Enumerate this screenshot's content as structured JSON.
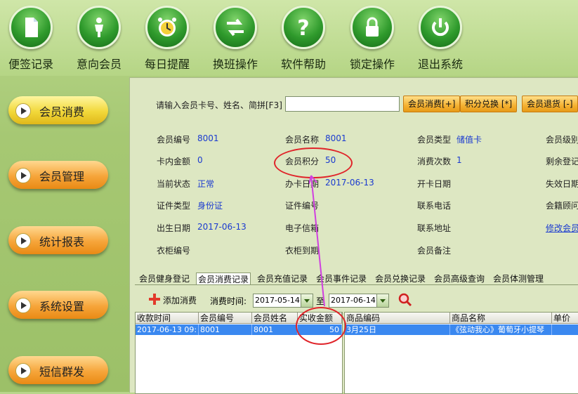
{
  "toolbar": [
    {
      "label": "便签记录",
      "icon": "document-icon"
    },
    {
      "label": "意向会员",
      "icon": "person-icon"
    },
    {
      "label": "每日提醒",
      "icon": "alarm-clock-icon"
    },
    {
      "label": "换班操作",
      "icon": "swap-arrows-icon"
    },
    {
      "label": "软件帮助",
      "icon": "question-icon"
    },
    {
      "label": "锁定操作",
      "icon": "lock-icon"
    },
    {
      "label": "退出系统",
      "icon": "power-icon"
    }
  ],
  "nav": [
    {
      "label": "会员消费",
      "style": "yellow"
    },
    {
      "label": "会员管理",
      "style": "orange"
    },
    {
      "label": "统计报表",
      "style": "orange"
    },
    {
      "label": "系统设置",
      "style": "orange"
    },
    {
      "label": "短信群发",
      "style": "orange"
    }
  ],
  "search": {
    "label": "请输入会员卡号、姓名、简拼[F3]",
    "value": "",
    "buttons": [
      "会员消费[+]",
      "积分兑换 [*]",
      "会员退货 [-]"
    ]
  },
  "member": {
    "r1": {
      "f1": "会员编号",
      "v1": "8001",
      "f2": "会员名称",
      "v2": "8001",
      "f3": "会员类型",
      "v3": "储值卡",
      "f4": "会员级别"
    },
    "r2": {
      "f1": "卡内金额",
      "v1": "0",
      "f2": "会员积分",
      "v2": "50",
      "f3": "消费次数",
      "v3": "1",
      "f4": "剩余登记"
    },
    "r3": {
      "f1": "当前状态",
      "v1": "正常",
      "f2": "办卡日期",
      "v2": "2017-06-13",
      "f3": "开卡日期",
      "f4": "失效日期"
    },
    "r4": {
      "f1": "证件类型",
      "v1": "身份证",
      "f2": "证件编号",
      "f3": "联系电话",
      "f4": "会籍顾问"
    },
    "r5": {
      "f1": "出生日期",
      "v1": "2017-06-13",
      "f2": "电子信箱",
      "f3": "联系地址",
      "link": "修改会员"
    },
    "r6": {
      "f1": "衣柜编号",
      "f2": "衣柜到期",
      "f3": "会员备注"
    }
  },
  "tabs": [
    "会员健身登记",
    "会员消费记录",
    "会员充值记录",
    "会员事件记录",
    "会员兑换记录",
    "会员高级查询",
    "会员体测管理"
  ],
  "records": {
    "add_label": "添加消费",
    "time_label": "消费时间:",
    "from": "2017-05-14",
    "to_label": "至",
    "to": "2017-06-14",
    "left_headers": [
      "收款时间",
      "会员编号",
      "会员姓名",
      "实收金额"
    ],
    "left_row": [
      "2017-06-13 09:",
      "8001",
      "8001",
      "50"
    ],
    "right_headers": [
      "商品编码",
      "商品名称",
      "单价"
    ],
    "right_row": [
      "3月25日",
      "《弦动我心》葡萄牙小提琴",
      ""
    ]
  },
  "colors": {
    "accent": "#3a88f0",
    "annotation": "#e0242a",
    "arrow": "#d040e0"
  }
}
